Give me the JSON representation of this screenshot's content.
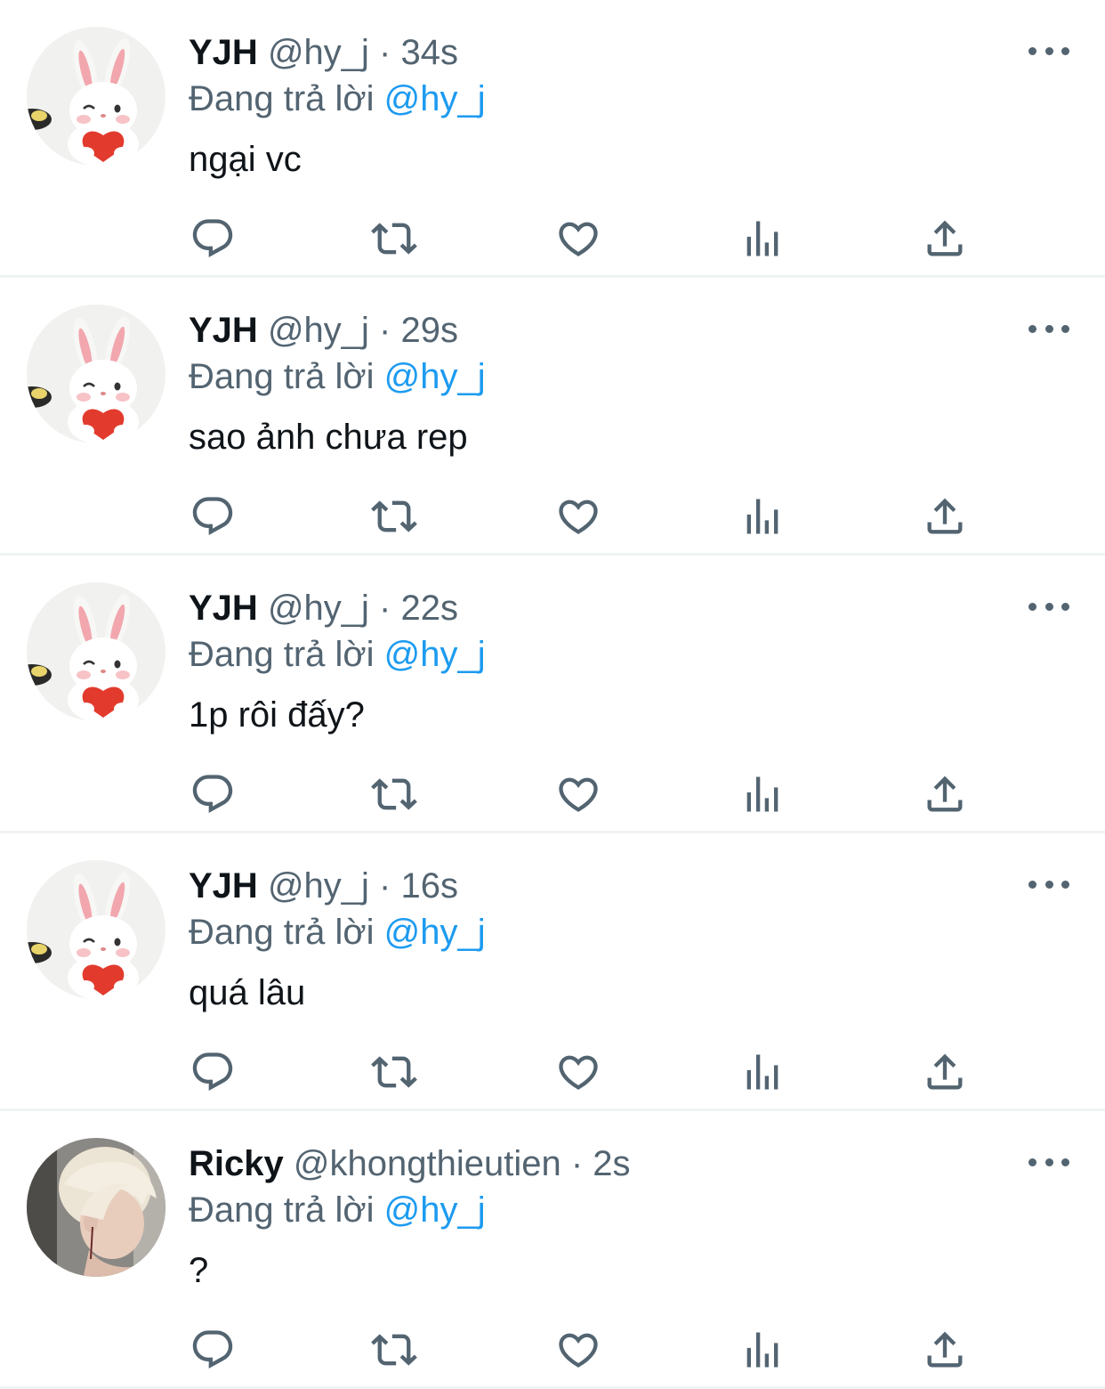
{
  "colors": {
    "text_primary": "#0f1419",
    "text_secondary": "#536471",
    "mention": "#1d9bf0",
    "divider": "#eff3f4"
  },
  "tweets": [
    {
      "name": "YJH",
      "handle": "@hy_j",
      "dot": "·",
      "time": "34s",
      "reply_prefix": "Đang trả lời",
      "reply_to": "@hy_j",
      "text": "ngại vc",
      "avatar": "bunny-avatar"
    },
    {
      "name": "YJH",
      "handle": "@hy_j",
      "dot": "·",
      "time": "29s",
      "reply_prefix": "Đang trả lời",
      "reply_to": "@hy_j",
      "text": "sao ảnh chưa rep",
      "avatar": "bunny-avatar"
    },
    {
      "name": "YJH",
      "handle": "@hy_j",
      "dot": "·",
      "time": "22s",
      "reply_prefix": "Đang trả lời",
      "reply_to": "@hy_j",
      "text": "1p rôi đấy?",
      "avatar": "bunny-avatar"
    },
    {
      "name": "YJH",
      "handle": "@hy_j",
      "dot": "·",
      "time": "16s",
      "reply_prefix": "Đang trả lời",
      "reply_to": "@hy_j",
      "text": "quá lâu",
      "avatar": "bunny-avatar"
    },
    {
      "name": "Ricky",
      "handle": "@khongthieutien",
      "dot": "·",
      "time": "2s",
      "reply_prefix": "Đang trả lời",
      "reply_to": "@hy_j",
      "text": "?",
      "avatar": "person-avatar"
    }
  ],
  "action_icons": [
    "reply-icon",
    "retweet-icon",
    "like-icon",
    "views-icon",
    "share-icon"
  ]
}
